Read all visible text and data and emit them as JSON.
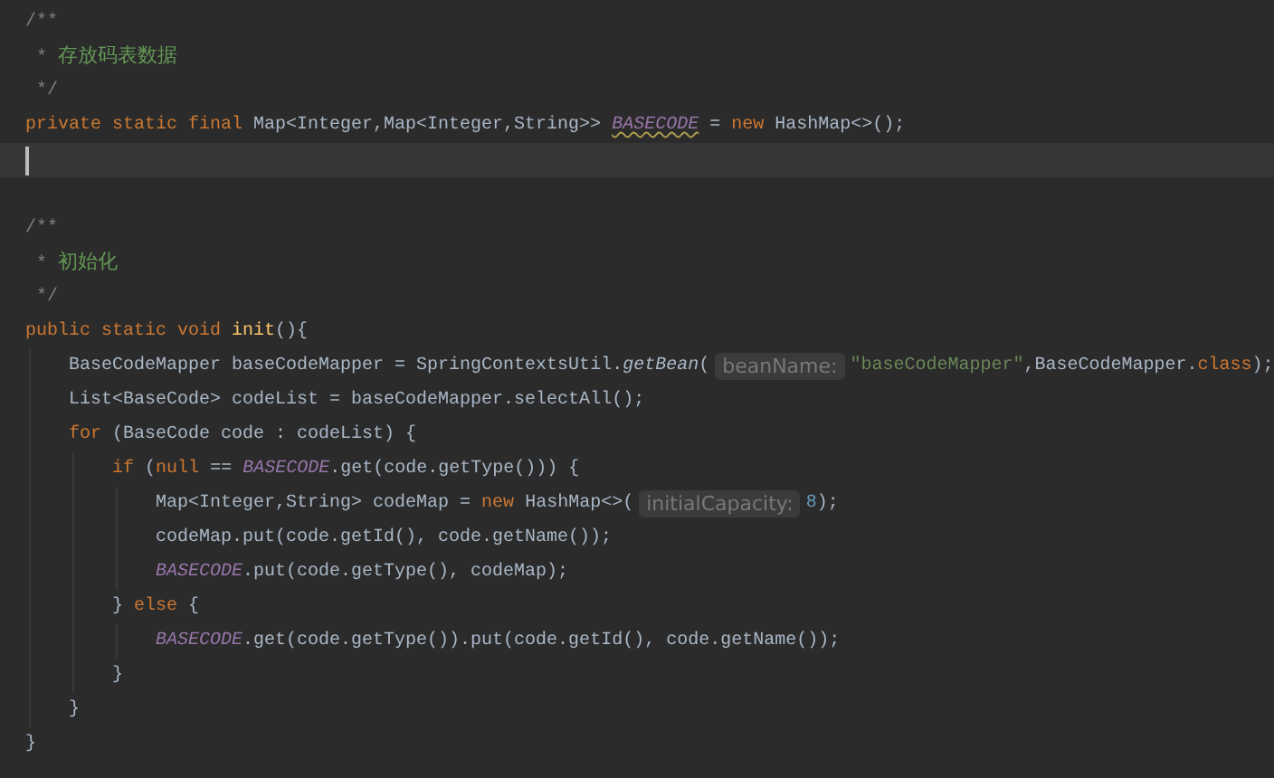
{
  "editor": {
    "lines": [
      {
        "kind": "code",
        "tokens": [
          {
            "text": "/**",
            "kind": "comment"
          }
        ]
      },
      {
        "kind": "code",
        "tokens": [
          {
            "text": " * ",
            "kind": "comment"
          },
          {
            "text": "存放码表数据",
            "kind": "doc"
          }
        ]
      },
      {
        "kind": "code",
        "tokens": [
          {
            "text": " */",
            "kind": "comment"
          }
        ]
      },
      {
        "kind": "code",
        "tokens": [
          {
            "text": "private static final ",
            "kind": "keyword"
          },
          {
            "text": "Map<Integer,Map<Integer,String>> ",
            "kind": "plain"
          },
          {
            "text": "BASECODE",
            "kind": "field",
            "warning": true
          },
          {
            "text": " = ",
            "kind": "plain"
          },
          {
            "text": "new ",
            "kind": "keyword"
          },
          {
            "text": "HashMap<>();",
            "kind": "plain"
          }
        ]
      },
      {
        "kind": "caret"
      },
      {
        "kind": "blank"
      },
      {
        "kind": "code",
        "tokens": [
          {
            "text": "/**",
            "kind": "comment"
          }
        ]
      },
      {
        "kind": "code",
        "tokens": [
          {
            "text": " * ",
            "kind": "comment"
          },
          {
            "text": "初始化",
            "kind": "doc"
          }
        ]
      },
      {
        "kind": "code",
        "tokens": [
          {
            "text": " */",
            "kind": "comment"
          }
        ]
      },
      {
        "kind": "code",
        "tokens": [
          {
            "text": "public static void ",
            "kind": "keyword"
          },
          {
            "text": "init",
            "kind": "method"
          },
          {
            "text": "(){",
            "kind": "plain"
          }
        ]
      },
      {
        "kind": "code",
        "tokens": [
          {
            "text": "    BaseCodeMapper baseCodeMapper = SpringContextsUtil.",
            "kind": "plain"
          },
          {
            "text": "getBean",
            "kind": "static-call"
          },
          {
            "text": "(",
            "kind": "plain"
          },
          {
            "text": "beanName:",
            "kind": "hint"
          },
          {
            "text": "\"baseCodeMapper\"",
            "kind": "string"
          },
          {
            "text": ",BaseCodeMapper.",
            "kind": "plain"
          },
          {
            "text": "class",
            "kind": "keyword"
          },
          {
            "text": ");",
            "kind": "plain"
          }
        ]
      },
      {
        "kind": "code",
        "tokens": [
          {
            "text": "    List<BaseCode> codeList = baseCodeMapper.selectAll();",
            "kind": "plain"
          }
        ]
      },
      {
        "kind": "code",
        "tokens": [
          {
            "text": "    for ",
            "kind": "keyword"
          },
          {
            "text": "(BaseCode code : codeList) {",
            "kind": "plain"
          }
        ]
      },
      {
        "kind": "code",
        "tokens": [
          {
            "text": "        if ",
            "kind": "keyword"
          },
          {
            "text": "(",
            "kind": "plain"
          },
          {
            "text": "null ",
            "kind": "keyword"
          },
          {
            "text": "== ",
            "kind": "plain"
          },
          {
            "text": "BASECODE",
            "kind": "field"
          },
          {
            "text": ".get(code.getType())) {",
            "kind": "plain"
          }
        ]
      },
      {
        "kind": "code",
        "tokens": [
          {
            "text": "            Map<Integer,String> codeMap = ",
            "kind": "plain"
          },
          {
            "text": "new ",
            "kind": "keyword"
          },
          {
            "text": "HashMap<>(",
            "kind": "plain"
          },
          {
            "text": "initialCapacity:",
            "kind": "hint"
          },
          {
            "text": "8",
            "kind": "number"
          },
          {
            "text": ");",
            "kind": "plain"
          }
        ]
      },
      {
        "kind": "code",
        "tokens": [
          {
            "text": "            codeMap.put(code.getId(), code.getName());",
            "kind": "plain"
          }
        ]
      },
      {
        "kind": "code",
        "tokens": [
          {
            "text": "            BASECODE",
            "kind": "field"
          },
          {
            "text": ".put(code.getType(), codeMap);",
            "kind": "plain"
          }
        ]
      },
      {
        "kind": "code",
        "tokens": [
          {
            "text": "        } ",
            "kind": "plain"
          },
          {
            "text": "else ",
            "kind": "keyword"
          },
          {
            "text": "{",
            "kind": "plain"
          }
        ]
      },
      {
        "kind": "code",
        "tokens": [
          {
            "text": "            BASECODE",
            "kind": "field"
          },
          {
            "text": ".get(code.getType()).put(code.getId(), code.getName());",
            "kind": "plain"
          }
        ]
      },
      {
        "kind": "code",
        "tokens": [
          {
            "text": "        }",
            "kind": "plain"
          }
        ]
      },
      {
        "kind": "code",
        "tokens": [
          {
            "text": "    }",
            "kind": "plain"
          }
        ]
      },
      {
        "kind": "code",
        "tokens": [
          {
            "text": "}",
            "kind": "plain"
          }
        ]
      }
    ]
  }
}
